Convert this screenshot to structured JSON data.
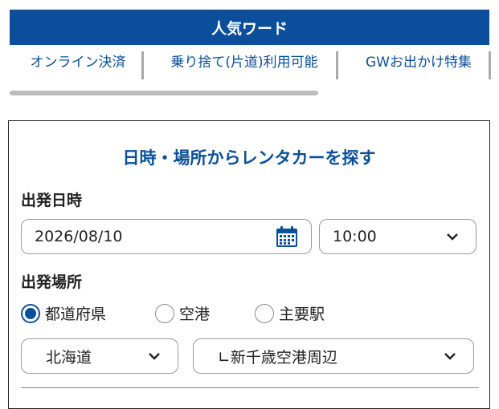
{
  "popular": {
    "title": "人気ワード"
  },
  "keywords": [
    {
      "label": "オンライン決済"
    },
    {
      "label": "乗り捨て(片道)利用可能"
    },
    {
      "label": "GWお出かけ特集"
    }
  ],
  "search": {
    "title": "日時・場所からレンタカーを探す",
    "departure_datetime_label": "出発日時",
    "date_value": "2026/08/10",
    "time_value": "10:00",
    "departure_place_label": "出発場所",
    "place_type_options": [
      {
        "label": "都道府県",
        "checked": true
      },
      {
        "label": "空港",
        "checked": false
      },
      {
        "label": "主要駅",
        "checked": false
      }
    ],
    "prefecture_value": "北海道",
    "location_value": "∟新千歳空港周辺"
  },
  "colors": {
    "brand": "#0b4f9c",
    "border": "#9a9a9a",
    "separator": "#a9a9a9"
  },
  "icons": {
    "calendar": "calendar-icon",
    "chevron": "chevron-down-icon"
  }
}
